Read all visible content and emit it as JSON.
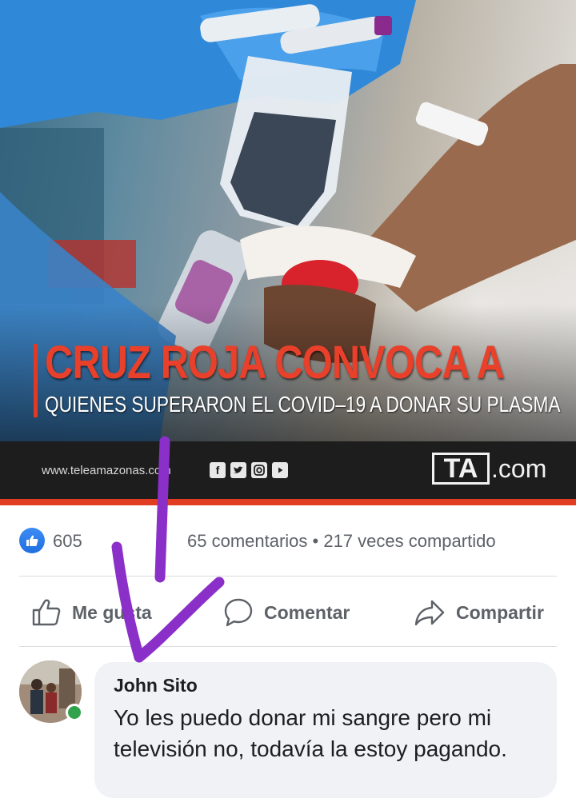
{
  "news_image": {
    "headline_main": "CRUZ ROJA CONVOCA A",
    "headline_sub": "QUIENES SUPERARON EL COVID–19 A DONAR SU PLASMA",
    "source_url": "www.teleamazonas.com",
    "social_icons": [
      "facebook-icon",
      "twitter-icon",
      "instagram-icon",
      "youtube-icon"
    ],
    "logo_mark": "TA",
    "logo_suffix": ".com",
    "accent_color": "#e03d22"
  },
  "stats": {
    "like_count": "605",
    "comments_shares": "65 comentarios • 217 veces compartido"
  },
  "actions": {
    "like_label": "Me gusta",
    "comment_label": "Comentar",
    "share_label": "Compartir"
  },
  "comment": {
    "author": "John Sito",
    "text": "Yo les puedo donar mi sangre pero mi televisión no, todavía la estoy pagando.",
    "status_color": "#31a24c"
  },
  "annotation": {
    "color": "#8b2fc9",
    "shape": "arrow"
  }
}
